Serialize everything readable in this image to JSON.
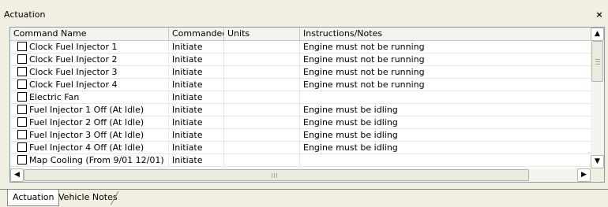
{
  "window": {
    "title": "Actuation",
    "close_glyph": "×"
  },
  "table": {
    "columns": [
      "Command Name",
      "Commanded",
      "Units",
      "Instructions/Notes"
    ],
    "rows": [
      {
        "name": "Clock Fuel Injector 1",
        "commanded": "Initiate",
        "units": "",
        "notes": "Engine must not be running"
      },
      {
        "name": "Clock Fuel Injector 2",
        "commanded": "Initiate",
        "units": "",
        "notes": "Engine must not be running"
      },
      {
        "name": "Clock Fuel Injector 3",
        "commanded": "Initiate",
        "units": "",
        "notes": "Engine must not be running"
      },
      {
        "name": "Clock Fuel Injector 4",
        "commanded": "Initiate",
        "units": "",
        "notes": "Engine must not be running"
      },
      {
        "name": "Electric Fan",
        "commanded": "Initiate",
        "units": "",
        "notes": ""
      },
      {
        "name": "Fuel Injector 1 Off (At Idle)",
        "commanded": "Initiate",
        "units": "",
        "notes": "Engine must be idling"
      },
      {
        "name": "Fuel Injector 2 Off (At Idle)",
        "commanded": "Initiate",
        "units": "",
        "notes": "Engine must be idling"
      },
      {
        "name": "Fuel Injector 3 Off (At Idle)",
        "commanded": "Initiate",
        "units": "",
        "notes": "Engine must be idling"
      },
      {
        "name": "Fuel Injector 4 Off (At Idle)",
        "commanded": "Initiate",
        "units": "",
        "notes": "Engine must be idling"
      },
      {
        "name": "Map Cooling (From 9/01  12/01)",
        "commanded": "Initiate",
        "units": "",
        "notes": ""
      }
    ]
  },
  "scrollbar": {
    "up": "▲",
    "down": "▼",
    "left": "◀",
    "right": "▶",
    "grip": "III"
  },
  "tabs": [
    {
      "label": "Actuation",
      "active": true
    },
    {
      "label": "Vehicle Notes",
      "active": false
    }
  ]
}
